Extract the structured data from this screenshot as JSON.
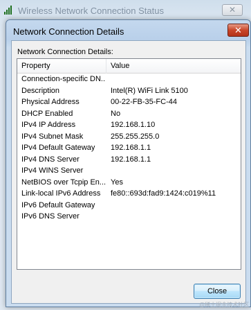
{
  "background_window": {
    "title": "Wireless Network Connection Status",
    "icon": "signal-bars-icon",
    "close_glyph": "✕"
  },
  "dialog": {
    "title": "Network Connection Details",
    "close_glyph": "✕",
    "section_label": "Network Connection Details:",
    "columns": {
      "property": "Property",
      "value": "Value"
    },
    "rows": [
      {
        "property": "Connection-specific DN...",
        "value": ""
      },
      {
        "property": "Description",
        "value": "Intel(R) WiFi Link 5100"
      },
      {
        "property": "Physical Address",
        "value": "00-22-FB-35-FC-44"
      },
      {
        "property": "DHCP Enabled",
        "value": "No"
      },
      {
        "property": "IPv4 IP Address",
        "value": "192.168.1.10"
      },
      {
        "property": "IPv4 Subnet Mask",
        "value": "255.255.255.0"
      },
      {
        "property": "IPv4 Default Gateway",
        "value": "192.168.1.1"
      },
      {
        "property": "IPv4 DNS Server",
        "value": "192.168.1.1"
      },
      {
        "property": "IPv4 WINS Server",
        "value": ""
      },
      {
        "property": "NetBIOS over Tcpip En...",
        "value": "Yes"
      },
      {
        "property": "Link-local IPv6 Address",
        "value": "fe80::693d:fad9:1424:c019%11"
      },
      {
        "property": "IPv6 Default Gateway",
        "value": ""
      },
      {
        "property": "IPv6 DNS Server",
        "value": ""
      }
    ],
    "close_button_label": "Close"
  },
  "watermark": "@稀土掘金技术社区",
  "colors": {
    "dialog_close_red": "#c9462a",
    "button_blue": "#3c7fb1",
    "frame_blue": "#b9d0ea"
  }
}
